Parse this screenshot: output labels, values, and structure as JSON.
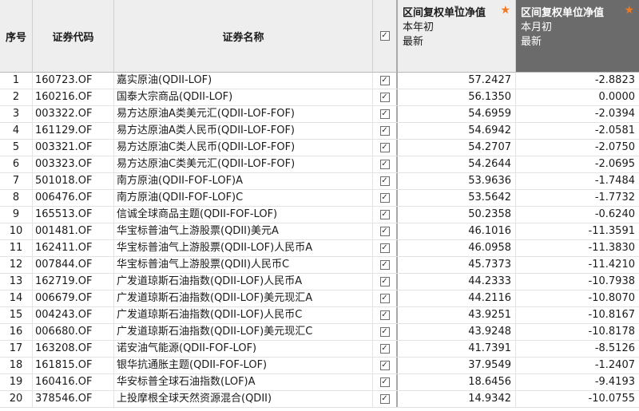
{
  "headers": {
    "index": "序号",
    "code": "证券代码",
    "name": "证券名称",
    "col1_title": "区间复权单位净值",
    "col1_sub1": "本年初",
    "col1_sub2": "最新",
    "col2_title": "区间复权单位净值",
    "col2_sub1": "本月初",
    "col2_sub2": "最新"
  },
  "rows": [
    {
      "idx": "1",
      "code": "160723.OF",
      "name": "嘉实原油(QDII-LOF)",
      "v1": "57.2427",
      "v2": "-2.8823"
    },
    {
      "idx": "2",
      "code": "160216.OF",
      "name": "国泰大宗商品(QDII-LOF)",
      "v1": "56.1350",
      "v2": "0.0000"
    },
    {
      "idx": "3",
      "code": "003322.OF",
      "name": "易方达原油A类美元汇(QDII-LOF-FOF)",
      "v1": "54.6959",
      "v2": "-2.0394"
    },
    {
      "idx": "4",
      "code": "161129.OF",
      "name": "易方达原油A类人民币(QDII-LOF-FOF)",
      "v1": "54.6942",
      "v2": "-2.0581"
    },
    {
      "idx": "5",
      "code": "003321.OF",
      "name": "易方达原油C类人民币(QDII-LOF-FOF)",
      "v1": "54.2707",
      "v2": "-2.0750"
    },
    {
      "idx": "6",
      "code": "003323.OF",
      "name": "易方达原油C类美元汇(QDII-LOF-FOF)",
      "v1": "54.2644",
      "v2": "-2.0695"
    },
    {
      "idx": "7",
      "code": "501018.OF",
      "name": "南方原油(QDII-FOF-LOF)A",
      "v1": "53.9636",
      "v2": "-1.7484"
    },
    {
      "idx": "8",
      "code": "006476.OF",
      "name": "南方原油(QDII-FOF-LOF)C",
      "v1": "53.5642",
      "v2": "-1.7732"
    },
    {
      "idx": "9",
      "code": "165513.OF",
      "name": "信诚全球商品主题(QDII-FOF-LOF)",
      "v1": "50.2358",
      "v2": "-0.6240"
    },
    {
      "idx": "10",
      "code": "001481.OF",
      "name": "华宝标普油气上游股票(QDII)美元A",
      "v1": "46.1016",
      "v2": "-11.3591"
    },
    {
      "idx": "11",
      "code": "162411.OF",
      "name": "华宝标普油气上游股票(QDII-LOF)人民币A",
      "v1": "46.0958",
      "v2": "-11.3830"
    },
    {
      "idx": "12",
      "code": "007844.OF",
      "name": "华宝标普油气上游股票(QDII)人民币C",
      "v1": "45.7373",
      "v2": "-11.4210"
    },
    {
      "idx": "13",
      "code": "162719.OF",
      "name": "广发道琼斯石油指数(QDII-LOF)人民币A",
      "v1": "44.2333",
      "v2": "-10.7938"
    },
    {
      "idx": "14",
      "code": "006679.OF",
      "name": "广发道琼斯石油指数(QDII-LOF)美元现汇A",
      "v1": "44.2116",
      "v2": "-10.8070"
    },
    {
      "idx": "15",
      "code": "004243.OF",
      "name": "广发道琼斯石油指数(QDII-LOF)人民币C",
      "v1": "43.9251",
      "v2": "-10.8167"
    },
    {
      "idx": "16",
      "code": "006680.OF",
      "name": "广发道琼斯石油指数(QDII-LOF)美元现汇C",
      "v1": "43.9248",
      "v2": "-10.8178"
    },
    {
      "idx": "17",
      "code": "163208.OF",
      "name": "诺安油气能源(QDII-FOF-LOF)",
      "v1": "41.7391",
      "v2": "-8.5126"
    },
    {
      "idx": "18",
      "code": "161815.OF",
      "name": "银华抗通胀主题(QDII-FOF-LOF)",
      "v1": "37.9549",
      "v2": "-1.2407"
    },
    {
      "idx": "19",
      "code": "160416.OF",
      "name": "华安标普全球石油指数(LOF)A",
      "v1": "18.6456",
      "v2": "-9.4193"
    },
    {
      "idx": "20",
      "code": "378546.OF",
      "name": "上投摩根全球天然资源混合(QDII)",
      "v1": "14.9342",
      "v2": "-10.0755"
    }
  ],
  "icons": {
    "star": "star-icon",
    "check": "checkbox-checked-icon",
    "star_color": "#f07820"
  }
}
